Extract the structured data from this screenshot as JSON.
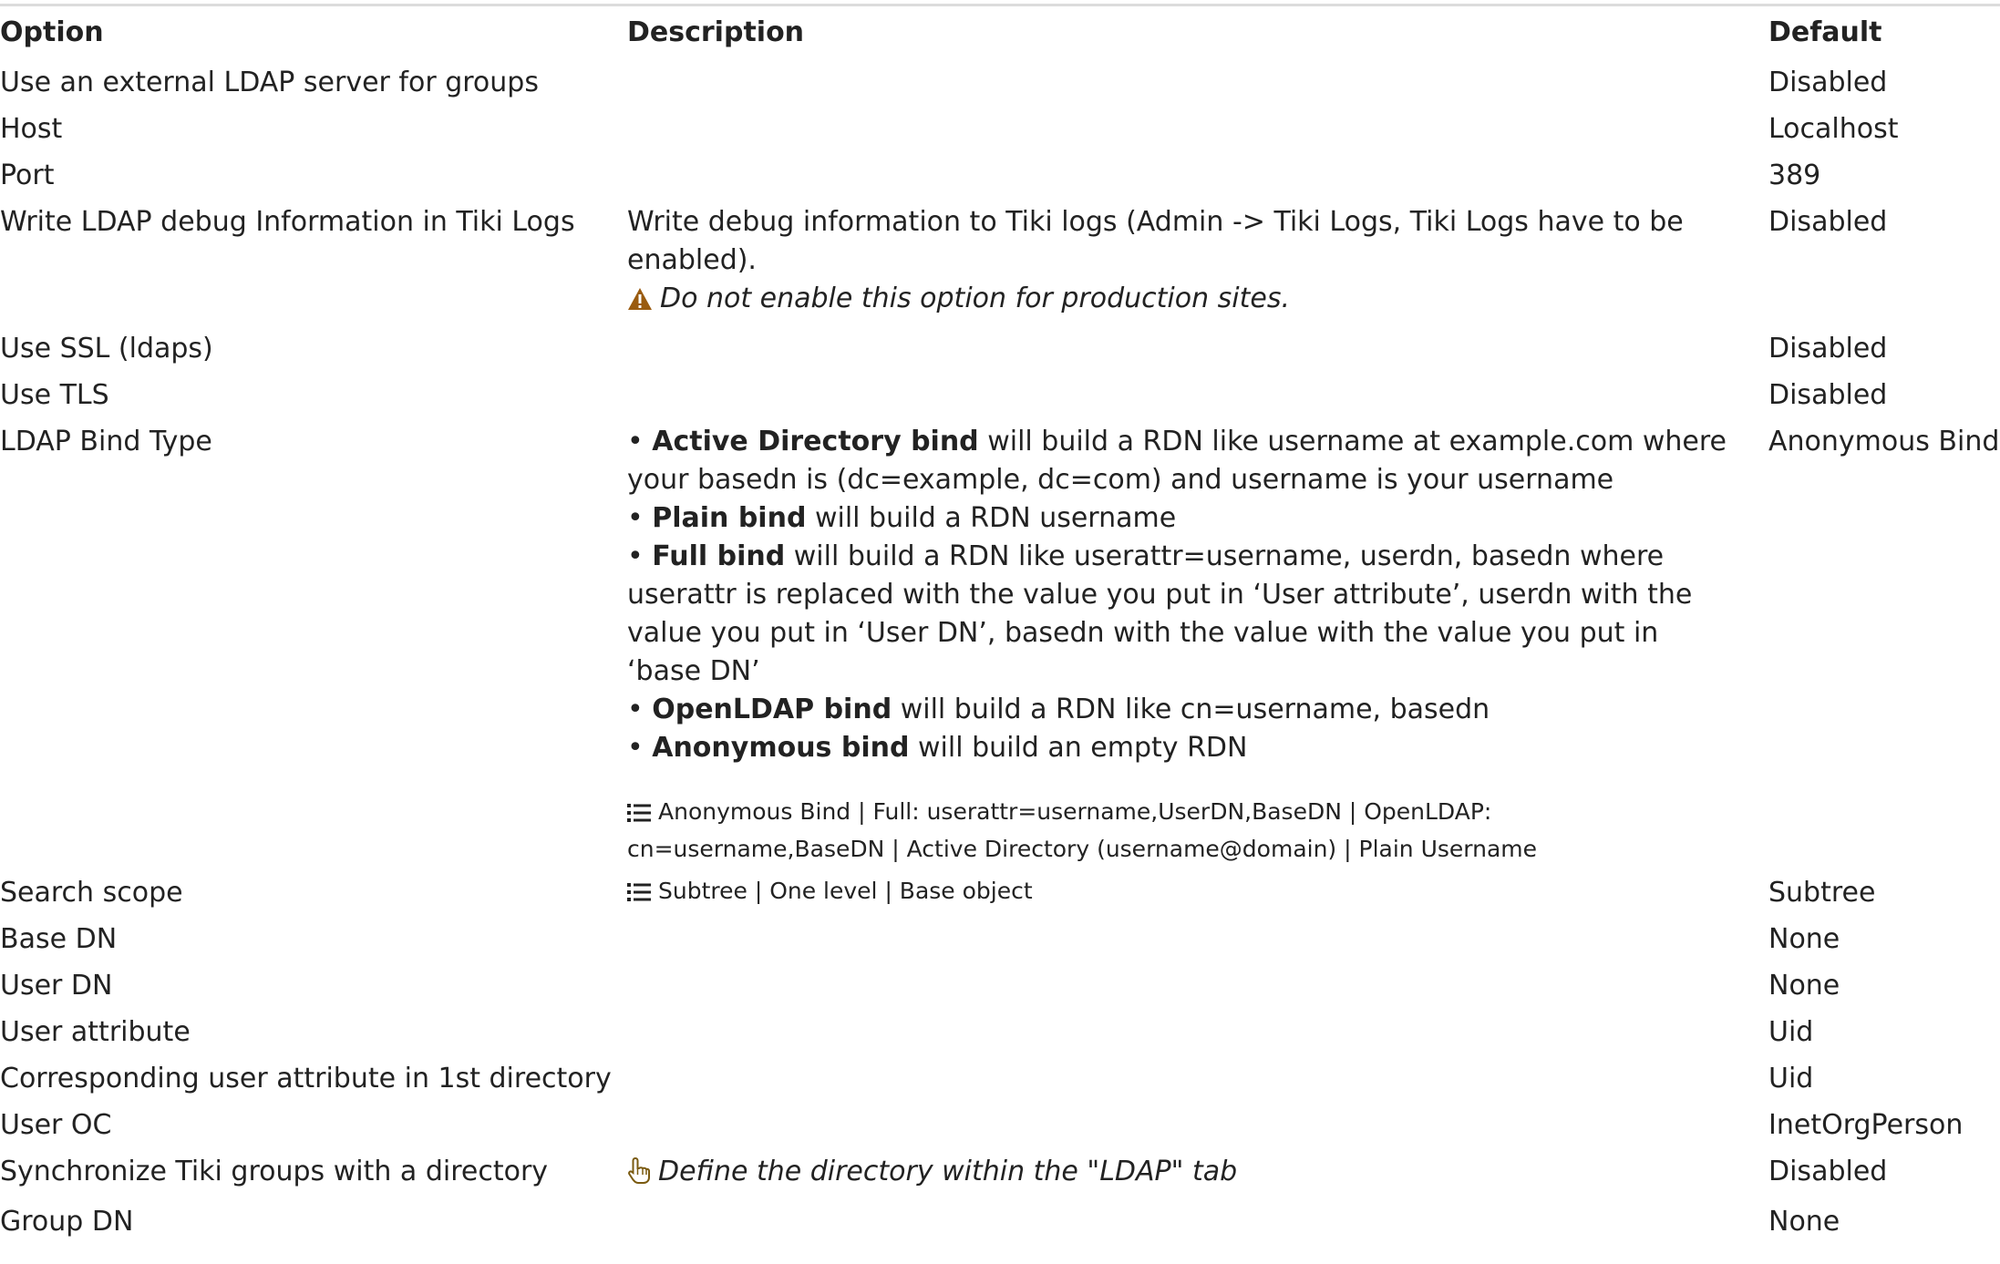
{
  "headers": {
    "option": "Option",
    "description": "Description",
    "default": "Default"
  },
  "rows": [
    {
      "option": "Use an external LDAP server for groups",
      "default": "Disabled"
    },
    {
      "option": "Host",
      "default": "Localhost"
    },
    {
      "option": "Port",
      "default": "389"
    },
    {
      "option": "Write LDAP debug Information in Tiki Logs",
      "default": "Disabled",
      "description": "Write debug information to Tiki logs (Admin -> Tiki Logs, Tiki Logs have to be enabled).",
      "warning": "Do not enable this option for production sites."
    },
    {
      "option": "Use SSL (ldaps)",
      "default": "Disabled"
    },
    {
      "option": "Use TLS",
      "default": "Disabled"
    },
    {
      "option": "LDAP Bind Type",
      "default": "Anonymous Bind",
      "bullets": [
        {
          "bold": "Active Directory bind",
          "text": " will build a RDN like username at example.com where your basedn is (dc=example, dc=com) and username is your username"
        },
        {
          "bold": "Plain bind",
          "text": " will build a RDN username"
        },
        {
          "bold": "Full bind",
          "text": " will build a RDN like userattr=username, userdn, basedn where userattr is replaced with the value you put in ‘User attribute’, userdn with the value you put in ‘User DN’, basedn with the value with the value you put in ‘base DN’"
        },
        {
          "bold": "OpenLDAP bind",
          "text": " will build a RDN like cn=username, basedn"
        },
        {
          "bold": "Anonymous bind",
          "text": " will build an empty RDN"
        }
      ],
      "options": "Anonymous Bind | Full: userattr=username,UserDN,BaseDN | OpenLDAP: cn=username,BaseDN | Active Directory (username@domain) | Plain Username"
    },
    {
      "option": "Search scope",
      "default": "Subtree",
      "options": "Subtree | One level | Base object"
    },
    {
      "option": "Base DN",
      "default": "None"
    },
    {
      "option": "User DN",
      "default": "None"
    },
    {
      "option": "User attribute",
      "default": "Uid"
    },
    {
      "option": "Corresponding user attribute in 1st directory",
      "default": "Uid"
    },
    {
      "option": "User OC",
      "default": "InetOrgPerson"
    },
    {
      "option": "Synchronize Tiki groups with a directory",
      "default": "Disabled",
      "note_prefix": "Define the directory within the \"",
      "note_link": "LDAP",
      "note_suffix": "\" tab"
    },
    {
      "option": "Group DN",
      "default": "None"
    }
  ],
  "icons": {
    "warning": "warning-triangle-icon",
    "list": "list-icon",
    "hand": "pointing-hand-icon",
    "warning_color": "#9a5b0f"
  }
}
